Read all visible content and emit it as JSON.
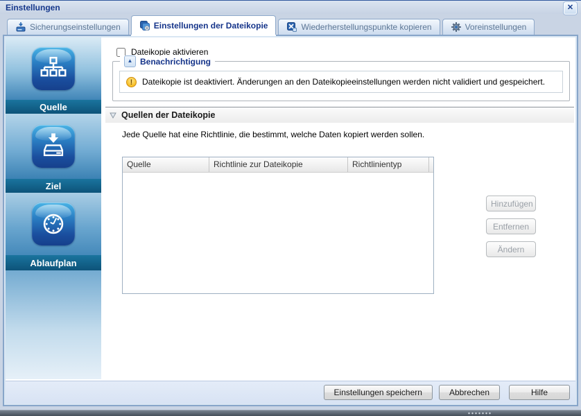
{
  "window": {
    "title": "Einstellungen",
    "close_glyph": "✕"
  },
  "tabs": [
    {
      "label": "Sicherungseinstellungen",
      "icon": "backup-settings-icon",
      "active": false
    },
    {
      "label": "Einstellungen der Dateikopie",
      "icon": "file-copy-settings-icon",
      "active": true
    },
    {
      "label": "Wiederherstellungspunkte kopieren",
      "icon": "copy-recovery-points-icon",
      "active": false
    },
    {
      "label": "Voreinstellungen",
      "icon": "preferences-icon",
      "active": false
    }
  ],
  "sidebar": {
    "items": [
      {
        "label": "Quelle",
        "icon": "source-network-icon"
      },
      {
        "label": "Ziel",
        "icon": "destination-drive-icon"
      },
      {
        "label": "Ablaufplan",
        "icon": "schedule-clock-icon"
      }
    ]
  },
  "main": {
    "enable_checkbox": {
      "label": "Dateikopie aktivieren",
      "checked": false
    },
    "notification": {
      "legend": "Benachrichtigung",
      "collapse_glyph": "▲",
      "warning_glyph": "!",
      "message": "Dateikopie ist deaktiviert. Änderungen an den Dateikopieeinstellungen werden nicht validiert und gespeichert."
    },
    "sources_section": {
      "title": "Quellen der Dateikopie",
      "description": "Jede Quelle hat eine Richtlinie, die bestimmt, welche Daten kopiert werden sollen.",
      "table": {
        "columns": [
          "Quelle",
          "Richtlinie zur Dateikopie",
          "Richtlinientyp"
        ],
        "rows": []
      },
      "actions": [
        {
          "label": "Hinzufügen",
          "enabled": false
        },
        {
          "label": "Entfernen",
          "enabled": false
        },
        {
          "label": "Ändern",
          "enabled": false
        }
      ]
    }
  },
  "footer": {
    "buttons": [
      {
        "label": "Einstellungen speichern",
        "enabled": true
      },
      {
        "label": "Abbrechen",
        "enabled": true
      },
      {
        "label": "Hilfe",
        "enabled": true
      }
    ]
  },
  "colors": {
    "titlebar_text": "#16388c",
    "window_chrome": "#c9d4e4",
    "dialog_frame": "#87a5c9",
    "sidebar_band": "#0d5379",
    "tile_blue_top": "#49b4e6",
    "tile_blue_bottom": "#16408c",
    "active_tab_text": "#15348a",
    "warning_orange": "#f7bd24"
  }
}
